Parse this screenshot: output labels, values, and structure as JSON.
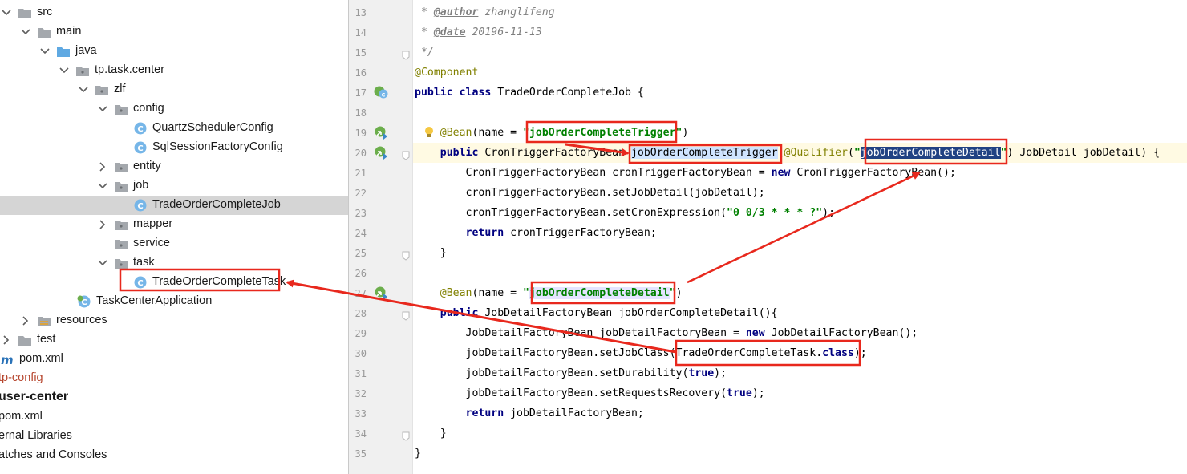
{
  "tree": {
    "items": [
      {
        "label": "src",
        "arrow": "down",
        "icon": "folder",
        "color": "normal"
      },
      {
        "label": "main",
        "arrow": "down",
        "icon": "folder",
        "color": "normal"
      },
      {
        "label": "java",
        "arrow": "down",
        "icon": "folder-blue",
        "color": "normal"
      },
      {
        "label": "tp.task.center",
        "arrow": "down",
        "icon": "package",
        "color": "normal"
      },
      {
        "label": "zlf",
        "arrow": "down",
        "icon": "package",
        "color": "normal"
      },
      {
        "label": "config",
        "arrow": "down",
        "icon": "package",
        "color": "normal"
      },
      {
        "label": "QuartzSchedulerConfig",
        "arrow": "",
        "icon": "class",
        "color": "normal"
      },
      {
        "label": "SqlSessionFactoryConfig",
        "arrow": "",
        "icon": "class",
        "color": "normal"
      },
      {
        "label": "entity",
        "arrow": "right",
        "icon": "package",
        "color": "normal"
      },
      {
        "label": "job",
        "arrow": "down",
        "icon": "package",
        "color": "normal"
      },
      {
        "label": "TradeOrderCompleteJob",
        "arrow": "",
        "icon": "class",
        "color": "normal",
        "selected": true
      },
      {
        "label": "mapper",
        "arrow": "right",
        "icon": "package",
        "color": "normal"
      },
      {
        "label": "service",
        "arrow": "",
        "icon": "package",
        "color": "normal"
      },
      {
        "label": "task",
        "arrow": "down",
        "icon": "package",
        "color": "normal"
      },
      {
        "label": "TradeOrderCompleteTask",
        "arrow": "",
        "icon": "class",
        "color": "normal"
      },
      {
        "label": "TaskCenterApplication",
        "arrow": "",
        "icon": "spring-class",
        "color": "normal"
      },
      {
        "label": "resources",
        "arrow": "right",
        "icon": "folder-res",
        "color": "normal"
      },
      {
        "label": "test",
        "arrow": "right",
        "icon": "folder",
        "color": "normal"
      },
      {
        "label": "pom.xml",
        "arrow": "",
        "icon": "maven",
        "color": "normal"
      },
      {
        "label": "tp-config",
        "arrow": "",
        "icon": "",
        "color": "red"
      },
      {
        "label": "user-center",
        "arrow": "",
        "icon": "",
        "color": "bold"
      },
      {
        "label": "pom.xml",
        "arrow": "",
        "icon": "",
        "color": "normal"
      },
      {
        "label": "ernal Libraries",
        "arrow": "",
        "icon": "",
        "color": "normal"
      },
      {
        "label": "atches and Consoles",
        "arrow": "",
        "icon": "",
        "color": "normal"
      }
    ]
  },
  "editor": {
    "lines": [
      {
        "num": "13",
        "gutter": "",
        "fold": false,
        "tokens": [
          {
            "t": " * ",
            "c": "cmt"
          },
          {
            "t": "@author",
            "c": "tag"
          },
          {
            "t": " zhanglifeng",
            "c": "cmt"
          }
        ]
      },
      {
        "num": "14",
        "gutter": "",
        "fold": false,
        "tokens": [
          {
            "t": " * ",
            "c": "cmt"
          },
          {
            "t": "@date",
            "c": "tag"
          },
          {
            "t": " 20196-11-13",
            "c": "cmt"
          }
        ]
      },
      {
        "num": "15",
        "gutter": "",
        "fold": true,
        "tokens": [
          {
            "t": " */",
            "c": "cmt"
          }
        ]
      },
      {
        "num": "16",
        "gutter": "",
        "fold": false,
        "tokens": [
          {
            "t": "@Component",
            "c": "ann"
          }
        ]
      },
      {
        "num": "17",
        "gutter": "class-gutter-icon",
        "fold": false,
        "tokens": [
          {
            "t": "public class ",
            "c": "kw"
          },
          {
            "t": "TradeOrderCompleteJob {",
            "c": ""
          }
        ]
      },
      {
        "num": "18",
        "gutter": "",
        "fold": false,
        "tokens": []
      },
      {
        "num": "19",
        "gutter": "bean-gutter-icon",
        "fold": false,
        "bulb": true,
        "tokens": [
          {
            "t": "    ",
            "c": ""
          },
          {
            "t": "@Bean",
            "c": "ann"
          },
          {
            "t": "(name = ",
            "c": ""
          },
          {
            "t": "\"jobOrderCompleteTrigger\"",
            "c": "str"
          },
          {
            "t": ")",
            "c": ""
          }
        ]
      },
      {
        "num": "20",
        "gutter": "bean-gutter-icon",
        "fold": true,
        "current": true,
        "tokens": [
          {
            "t": "    ",
            "c": ""
          },
          {
            "t": "public ",
            "c": "kw"
          },
          {
            "t": "CronTriggerFactoryBean ",
            "c": ""
          },
          {
            "t": "jobOrderCompleteTrigger",
            "c": "hl"
          },
          {
            "t": "(",
            "c": ""
          },
          {
            "t": "@Qualifier",
            "c": "ann"
          },
          {
            "t": "(",
            "c": ""
          },
          {
            "t": "\"",
            "c": "str"
          },
          {
            "t": "jobOrderCompleteDetail",
            "c": "hl-sel"
          },
          {
            "t": "\"",
            "c": "str"
          },
          {
            "t": ") JobDetail jobDetail) {",
            "c": ""
          }
        ]
      },
      {
        "num": "21",
        "gutter": "",
        "fold": false,
        "tokens": [
          {
            "t": "        CronTriggerFactoryBean cronTriggerFactoryBean = ",
            "c": ""
          },
          {
            "t": "new ",
            "c": "kw"
          },
          {
            "t": "CronTriggerFactoryBean();",
            "c": ""
          }
        ]
      },
      {
        "num": "22",
        "gutter": "",
        "fold": false,
        "tokens": [
          {
            "t": "        cronTriggerFactoryBean.setJobDetail(jobDetail);",
            "c": ""
          }
        ]
      },
      {
        "num": "23",
        "gutter": "",
        "fold": false,
        "tokens": [
          {
            "t": "        cronTriggerFactoryBean.setCronExpression(",
            "c": ""
          },
          {
            "t": "\"0 0/3 * * * ?\"",
            "c": "str"
          },
          {
            "t": ");",
            "c": ""
          }
        ]
      },
      {
        "num": "24",
        "gutter": "",
        "fold": false,
        "tokens": [
          {
            "t": "        ",
            "c": ""
          },
          {
            "t": "return ",
            "c": "kw"
          },
          {
            "t": "cronTriggerFactoryBean;",
            "c": ""
          }
        ]
      },
      {
        "num": "25",
        "gutter": "",
        "fold": true,
        "tokens": [
          {
            "t": "    }",
            "c": ""
          }
        ]
      },
      {
        "num": "26",
        "gutter": "",
        "fold": false,
        "tokens": []
      },
      {
        "num": "27",
        "gutter": "bean-gutter-icon",
        "fold": false,
        "tokens": [
          {
            "t": "    ",
            "c": ""
          },
          {
            "t": "@Bean",
            "c": "ann"
          },
          {
            "t": "(name = ",
            "c": ""
          },
          {
            "t": "\"",
            "c": "str"
          },
          {
            "t": "jobOrderCompleteDetail",
            "c": "str hl-blue"
          },
          {
            "t": "\"",
            "c": "str"
          },
          {
            "t": ")",
            "c": ""
          }
        ]
      },
      {
        "num": "28",
        "gutter": "",
        "fold": true,
        "tokens": [
          {
            "t": "    ",
            "c": ""
          },
          {
            "t": "public ",
            "c": "kw"
          },
          {
            "t": "JobDetailFactoryBean jobOrderCompleteDetail(){",
            "c": ""
          }
        ]
      },
      {
        "num": "29",
        "gutter": "",
        "fold": false,
        "tokens": [
          {
            "t": "        JobDetailFactoryBean jobDetailFactoryBean = ",
            "c": ""
          },
          {
            "t": "new ",
            "c": "kw"
          },
          {
            "t": "JobDetailFactoryBean();",
            "c": ""
          }
        ]
      },
      {
        "num": "30",
        "gutter": "",
        "fold": false,
        "tokens": [
          {
            "t": "        jobDetailFactoryBean.setJobClass(TradeOrderCompleteTask.",
            "c": ""
          },
          {
            "t": "class",
            "c": "kw"
          },
          {
            "t": ");",
            "c": ""
          }
        ]
      },
      {
        "num": "31",
        "gutter": "",
        "fold": false,
        "tokens": [
          {
            "t": "        jobDetailFactoryBean.setDurability(",
            "c": ""
          },
          {
            "t": "true",
            "c": "kw"
          },
          {
            "t": ");",
            "c": ""
          }
        ]
      },
      {
        "num": "32",
        "gutter": "",
        "fold": false,
        "tokens": [
          {
            "t": "        jobDetailFactoryBean.setRequestsRecovery(",
            "c": ""
          },
          {
            "t": "true",
            "c": "kw"
          },
          {
            "t": ");",
            "c": ""
          }
        ]
      },
      {
        "num": "33",
        "gutter": "",
        "fold": false,
        "tokens": [
          {
            "t": "        ",
            "c": ""
          },
          {
            "t": "return ",
            "c": "kw"
          },
          {
            "t": "jobDetailFactoryBean;",
            "c": ""
          }
        ]
      },
      {
        "num": "34",
        "gutter": "",
        "fold": true,
        "tokens": [
          {
            "t": "    }",
            "c": ""
          }
        ]
      },
      {
        "num": "35",
        "gutter": "",
        "fold": false,
        "tokens": [
          {
            "t": "}",
            "c": ""
          }
        ]
      }
    ]
  },
  "colors": {
    "annotation_red": "#e8281d",
    "selected_row": "#d5d5d5",
    "keyword": "#000080",
    "string": "#008000",
    "annotation": "#808000"
  }
}
